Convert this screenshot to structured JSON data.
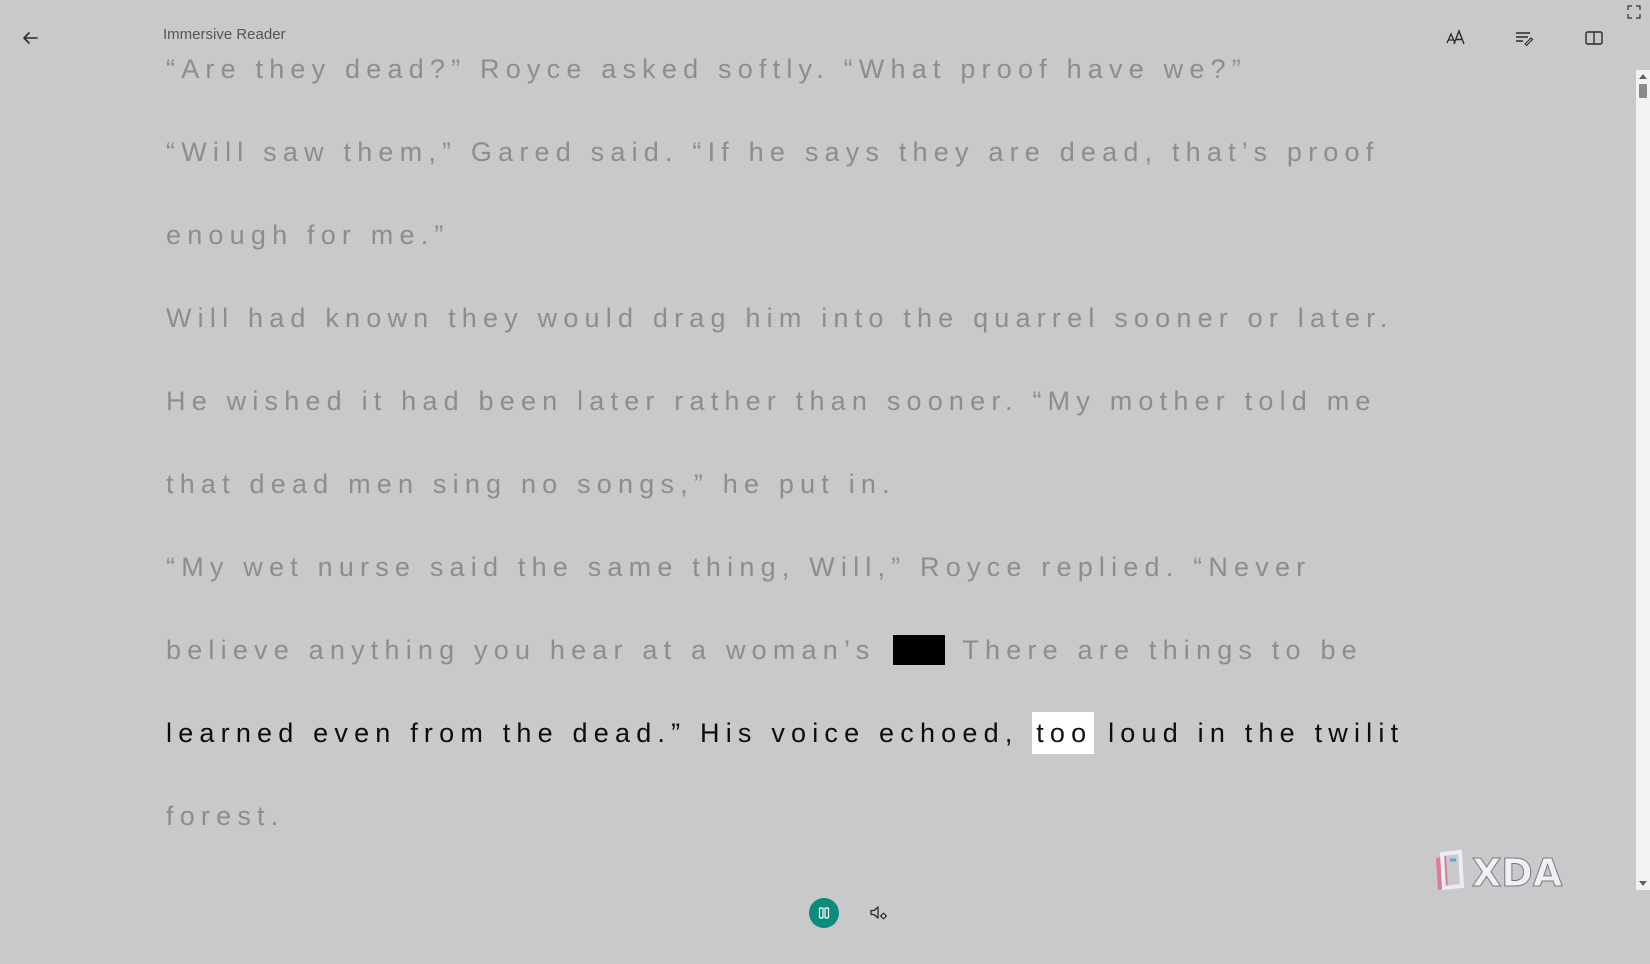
{
  "header": {
    "title": "Immersive Reader",
    "back_icon": "arrow-left-icon",
    "text_preferences_icon": "text-size-icon",
    "grammar_options_icon": "grammar-options-icon",
    "reading_preferences_icon": "reading-preferences-icon",
    "fullscreen_icon": "fullscreen-icon"
  },
  "content": {
    "lines": [
      "“Are they dead?” Royce asked softly. “What proof have we?”",
      "“Will saw them,” Gared said. “If he says they are dead, that’s proof",
      "enough for me.”",
      "Will had known they would drag him into the quarrel sooner or later.",
      "He wished it had been later rather than sooner. “My mother told me",
      "that dead men sing no songs,” he put in.",
      "“My wet nurse said the same thing, Will,” Royce replied. “Never"
    ],
    "redacted_line": {
      "before": "believe anything you hear at a woman’s",
      "after": "There are things to be"
    },
    "active_line": {
      "before": "learned even from the dead.” His voice echoed,",
      "highlighted_word": "too",
      "after": "loud in the twilit"
    },
    "last_line": "forest."
  },
  "controls": {
    "play_pause_icon": "pause-icon",
    "voice_settings_icon": "voice-settings-icon"
  },
  "colors": {
    "background": "#c9c9cb",
    "dim_text": "#8d8d90",
    "active_text": "#0c0c0c",
    "accent": "#0d8c7e"
  },
  "watermark": {
    "text": "XDA"
  }
}
